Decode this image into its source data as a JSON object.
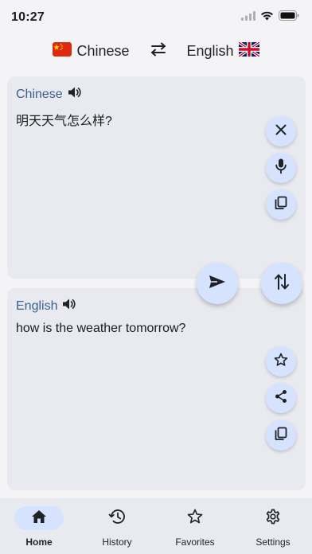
{
  "status_bar": {
    "time": "10:27",
    "icons": [
      "signal-icon",
      "wifi-icon",
      "battery-icon"
    ]
  },
  "language_bar": {
    "source_language": "Chinese",
    "source_flag": "china-flag-icon",
    "target_language": "English",
    "target_flag": "uk-flag-icon",
    "swap_icon": "swap-horizontal-icon"
  },
  "source_card": {
    "language": "Chinese",
    "text": "明天天气怎么样?",
    "actions": [
      "clear-icon",
      "microphone-icon",
      "copy-icon"
    ]
  },
  "target_card": {
    "language": "English",
    "text": "how is the weather tomorrow?",
    "actions": [
      "star-icon",
      "share-icon",
      "copy-icon"
    ]
  },
  "floating_actions": [
    "send-icon",
    "swap-vertical-icon"
  ],
  "bottom_nav": {
    "items": [
      {
        "label": "Home",
        "icon": "home-icon",
        "active": true
      },
      {
        "label": "History",
        "icon": "history-icon",
        "active": false
      },
      {
        "label": "Favorites",
        "icon": "star-icon",
        "active": false
      },
      {
        "label": "Settings",
        "icon": "gear-icon",
        "active": false
      }
    ]
  },
  "colors": {
    "accent": "#d6e3ff",
    "language_label": "#3b5f8f",
    "card_background": "#e9eaef",
    "page_background": "#f4f4f6"
  }
}
